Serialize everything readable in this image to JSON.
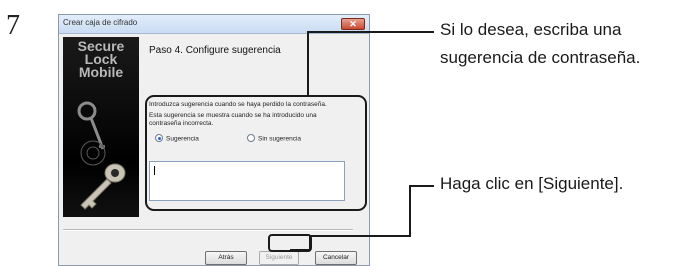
{
  "step_number": "7",
  "window": {
    "title": "Crear caja de cifrado",
    "close_symbol": "✕",
    "logo_line1": "Secure",
    "logo_line2": "Lock",
    "logo_line3": "Mobile",
    "step_title": "Paso 4. Configure sugerencia",
    "instruction": "Introduzca sugerencia cuando se  haya perdido la contraseña.",
    "note_line1": "Esta sugerencia se muestra cuando se ha introducido una",
    "note_line2": "contraseña incorrecta.",
    "radio_options": [
      {
        "label": "Sugerencia",
        "selected": true
      },
      {
        "label": "Sin sugerencia",
        "selected": false
      }
    ],
    "hint_value": "",
    "buttons": {
      "back": "Atrás",
      "next": "Siguiente",
      "cancel": "Cancelar"
    }
  },
  "callouts": {
    "hint_line1": "Si lo desea, escriba una",
    "hint_line2": "sugerencia de contraseña.",
    "next_text": "Haga clic en [Siguiente]."
  }
}
